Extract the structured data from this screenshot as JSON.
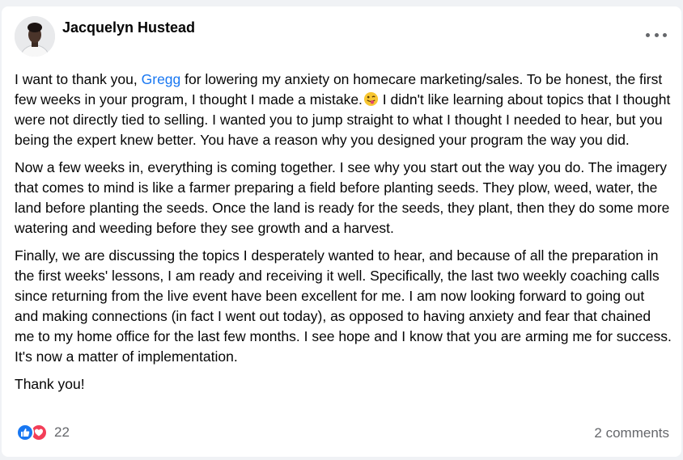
{
  "post": {
    "author": "Jacquelyn Hustead",
    "paragraph1": {
      "before_mention": "I want to thank you, ",
      "mention": "Gregg",
      "after_mention": " for lowering my anxiety on homecare marketing/sales. To be honest, the first few weeks in your program, I thought I made a mistake.",
      "after_emoji": " I didn't like learning about topics that I thought were not directly tied to selling. I wanted you to jump straight to what I thought I needed to hear, but you being the expert knew better. You have a reason why you designed your program the way you did."
    },
    "paragraph2": "Now a few weeks in, everything is coming together. I see why you start out the way you do. The imagery that comes to mind is like a farmer preparing a field before planting seeds. They plow, weed, water, the land before planting the seeds. Once the land is ready for the seeds, they plant, then they do some more watering and weeding before they see growth and a harvest.",
    "paragraph3": "Finally, we are discussing the topics I desperately wanted to hear, and because of all the preparation in the first weeks' lessons, I am ready and receiving it well. Specifically, the last two weekly coaching calls since returning from the live event have been excellent for me. I am now looking forward to going out and making connections (in fact I went out today), as opposed to having anxiety and fear that chained me to my home office for the last few months. I see hope and I know that you are arming me for success. It's now a matter of implementation.",
    "paragraph4": "Thank you!",
    "emoji_icon": "winking-tongue-emoji-icon"
  },
  "footer": {
    "reaction_icons": [
      "like-icon",
      "love-icon"
    ],
    "reaction_count": "22",
    "comments_label": "2 comments"
  },
  "colors": {
    "mention": "#1877f2",
    "like": "#1877f2",
    "love": "#f33e58",
    "muted_text": "#65676b"
  }
}
